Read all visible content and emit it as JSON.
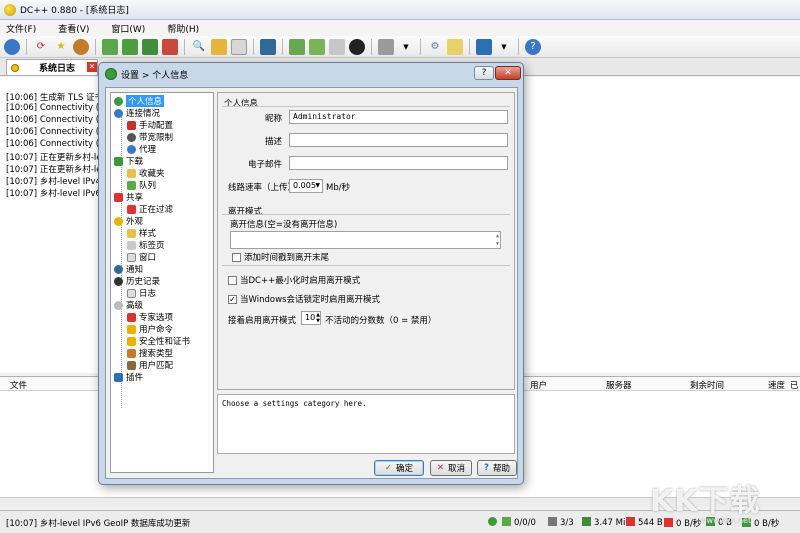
{
  "window": {
    "title": "DC++ 0.880 - [系统日志]"
  },
  "menu": [
    "文件(F)",
    "查看(V)",
    "窗口(W)",
    "帮助(H)"
  ],
  "tabs": [
    {
      "label": "系统日志"
    }
  ],
  "log_lines": [
    "[10:06] 生成新 TLS 证书",
    "[10:06] Connectivity (IPv4",
    "[10:06] Connectivity (IPv4",
    "[10:06] Connectivity (IPv6",
    "[10:06] Connectivity (IPv6",
    "[10:07] 正在更新乡村-level",
    "[10:07] 正在更新乡村-level",
    "[10:07] 乡村-level IPv4 Ge",
    "[10:07] 乡村-level IPv6 Ge"
  ],
  "transfers": {
    "columns": [
      "文件",
      "用户",
      "服务器",
      "剩余时间",
      "速度",
      "已传"
    ]
  },
  "status": {
    "text": "[10:07] 乡村-level IPv6 GeoIP 数据库成功更新",
    "slots_free": "0/0/0",
    "slots": "3/3",
    "download_total": "3.47 MiB",
    "upload_total": "544 B",
    "upload_rate": "0 B/秒",
    "download_total2": "0 B",
    "download_rate": "0 B/秒"
  },
  "watermark": {
    "main": "KK下载",
    "sub": "www.kkx.net"
  },
  "dialog": {
    "title": "设置 > 个人信息",
    "help_btn": "?",
    "close_btn": "✕",
    "tree": [
      {
        "label": "个人信息",
        "level": 0,
        "selected": true
      },
      {
        "label": "连接情况",
        "level": 0
      },
      {
        "label": "手动配置",
        "level": 1
      },
      {
        "label": "带宽限制",
        "level": 1
      },
      {
        "label": "代理",
        "level": 1
      },
      {
        "label": "下载",
        "level": 0
      },
      {
        "label": "收藏夹",
        "level": 1
      },
      {
        "label": "队列",
        "level": 1
      },
      {
        "label": "共享",
        "level": 0
      },
      {
        "label": "正在过滤",
        "level": 1
      },
      {
        "label": "外观",
        "level": 0
      },
      {
        "label": "样式",
        "level": 1
      },
      {
        "label": "标签页",
        "level": 1
      },
      {
        "label": "窗口",
        "level": 1
      },
      {
        "label": "通知",
        "level": 0
      },
      {
        "label": "历史记录",
        "level": 0
      },
      {
        "label": "日志",
        "level": 1
      },
      {
        "label": "高级",
        "level": 0
      },
      {
        "label": "专家选项",
        "level": 1
      },
      {
        "label": "用户命令",
        "level": 1
      },
      {
        "label": "安全性和证书",
        "level": 1
      },
      {
        "label": "搜索类型",
        "level": 1
      },
      {
        "label": "用户匹配",
        "level": 1
      },
      {
        "label": "插件",
        "level": 0
      }
    ],
    "personal": {
      "group_title": "个人信息",
      "nick_label": "昵称",
      "nick_value": "Administrator",
      "desc_label": "描述",
      "desc_value": "",
      "email_label": "电子邮件",
      "email_value": "",
      "speed_label": "线路速率（上传）",
      "speed_value": "0.005",
      "speed_unit": "Mb/秒"
    },
    "away": {
      "group_title": "离开模式",
      "msg_label": "离开信息(空=没有离开信息)",
      "msg_value": "",
      "timestamp_label": "添加时间戳到离开末尾",
      "timestamp_checked": false,
      "minimize_label": "当DC++最小化时启用离开模式",
      "minimize_checked": false,
      "lock_label": "当Windows会话锁定时启用离开模式",
      "lock_checked": true,
      "idle_prefix": "接着启用离开模式",
      "idle_value": "10",
      "idle_suffix": "不活动的分数数（0 = 禁用）"
    },
    "description": "Choose a settings category here.",
    "buttons": {
      "ok": "确定",
      "cancel": "取消",
      "help": "帮助"
    }
  }
}
